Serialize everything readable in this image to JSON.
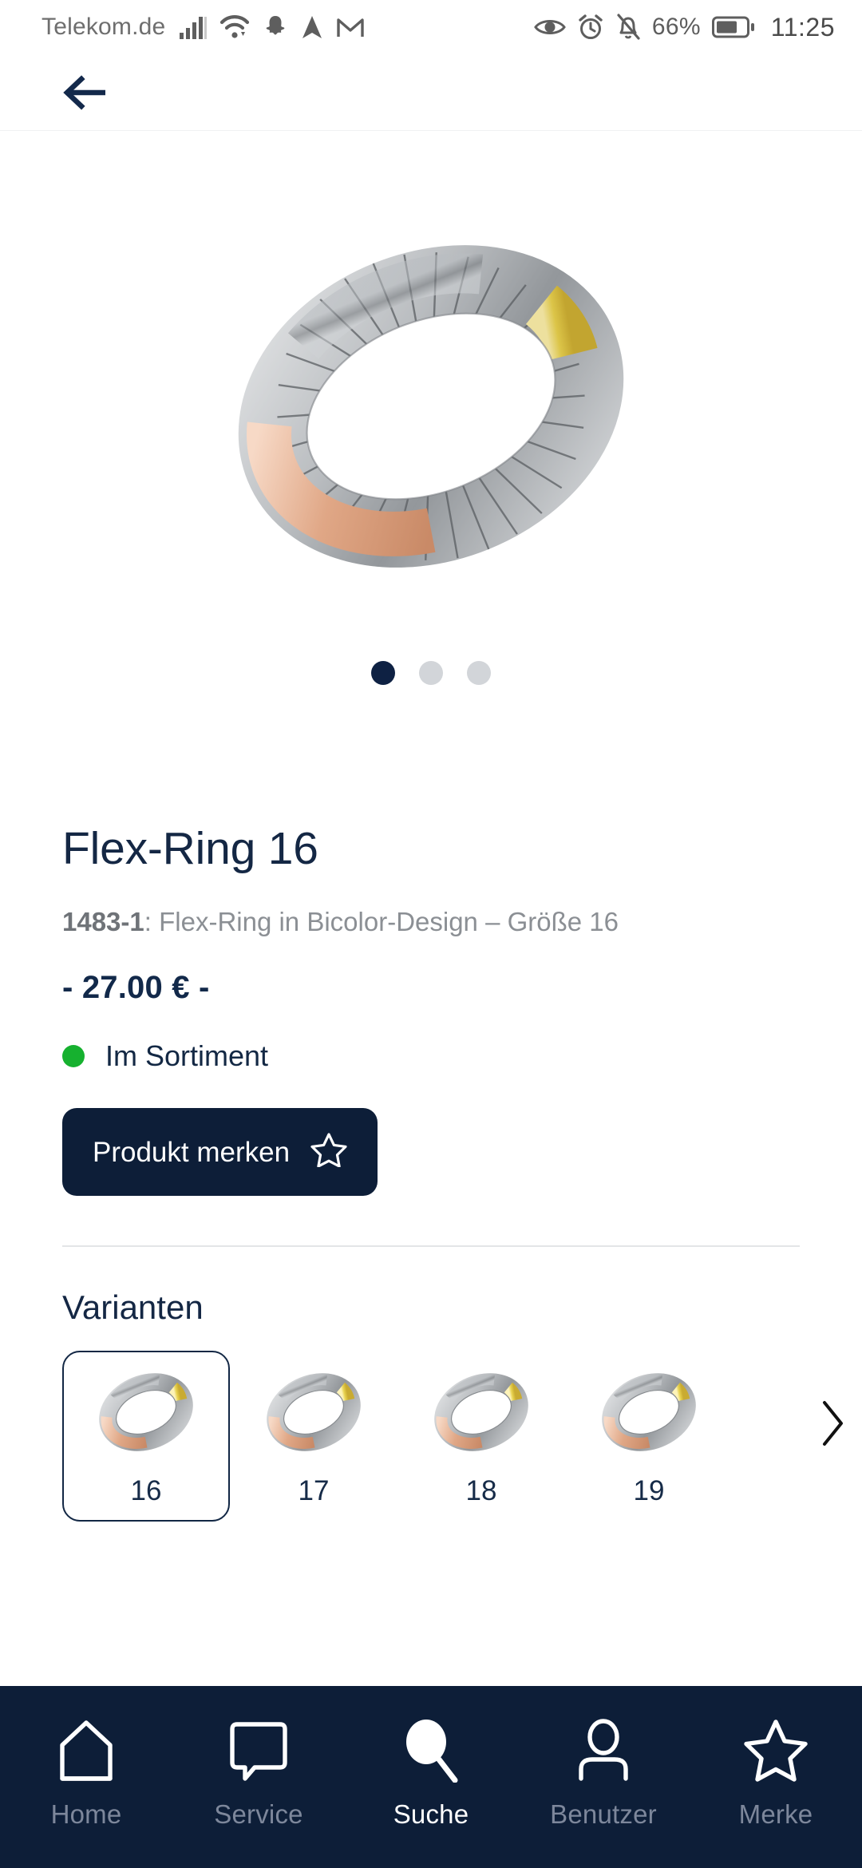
{
  "status_bar": {
    "carrier": "Telekom.de",
    "left_icons": [
      "signal-bars-icon",
      "wifi-icon",
      "snapchat-icon",
      "navigation-arrow-icon",
      "gmail-icon"
    ],
    "right_icons": [
      "eye-icon",
      "alarm-clock-icon",
      "bell-muted-icon"
    ],
    "battery_percent": "66%",
    "battery_icon": "battery-icon",
    "time": "11:25"
  },
  "header": {
    "back_icon": "arrow-left-icon"
  },
  "gallery": {
    "image_alt": "flex-ring-product-image",
    "dot_count": 3,
    "active_dot": 0
  },
  "product": {
    "title": "Flex-Ring 16",
    "sku": "1483-1",
    "subtitle_separator": ": ",
    "subtitle": "Flex-Ring in Bicolor-Design – Größe 16",
    "price": "- 27.00 € -",
    "stock_label": "Im Sortiment",
    "stock_color": "#16b12f",
    "merk_button_label": "Produkt merken",
    "merk_button_icon": "star-outline-icon",
    "accent_color": "#0d1e38"
  },
  "variants": {
    "heading": "Varianten",
    "next_icon": "chevron-right-icon",
    "items": [
      {
        "label": "16",
        "selected": true
      },
      {
        "label": "17",
        "selected": false
      },
      {
        "label": "18",
        "selected": false
      },
      {
        "label": "19",
        "selected": false
      }
    ]
  },
  "bottom_nav": {
    "items": [
      {
        "label": "Home",
        "icon": "home-icon",
        "active": false
      },
      {
        "label": "Service",
        "icon": "chat-bubble-icon",
        "active": false
      },
      {
        "label": "Suche",
        "icon": "search-icon",
        "active": true
      },
      {
        "label": "Benutzer",
        "icon": "user-icon",
        "active": false
      },
      {
        "label": "Merke",
        "icon": "star-icon",
        "active": false
      }
    ]
  }
}
